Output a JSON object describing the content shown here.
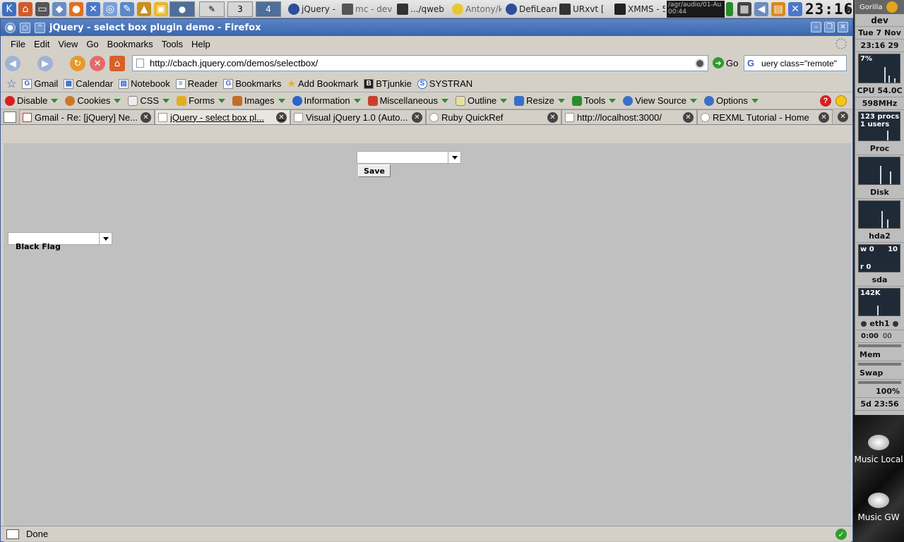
{
  "taskbar": {
    "desktop_number": "3",
    "active_desktop": "4",
    "tasks": [
      {
        "label": "jQuery -",
        "color": "#2b4f9b"
      },
      {
        "label": "mc - dev",
        "color": "#555555"
      },
      {
        "label": ".../qweb",
        "color": "#333333"
      },
      {
        "label": "Antony/k",
        "color": "#e8c830"
      },
      {
        "label": "DefiLearn",
        "color": "#2b4f9b"
      },
      {
        "label": "URxvt [",
        "color": "#333333"
      },
      {
        "label": "XMMS - 5",
        "color": "#222222"
      }
    ],
    "xmms_line1": "/agr/audio/01-Au",
    "xmms_line2": "00:44",
    "clock": "23:16"
  },
  "window": {
    "title": "jQuery - select box plugin demo - Firefox"
  },
  "menu": [
    "File",
    "Edit",
    "View",
    "Go",
    "Bookmarks",
    "Tools",
    "Help"
  ],
  "nav": {
    "url": "http://cbach.jquery.com/demos/selectbox/",
    "go_label": "Go",
    "search_value": "uery class=\"remote\""
  },
  "bookmarks": [
    {
      "label": "Gmail",
      "icon": "G"
    },
    {
      "label": "Calendar",
      "icon": "C"
    },
    {
      "label": "Notebook",
      "icon": "N"
    },
    {
      "label": "Reader",
      "icon": "R"
    },
    {
      "label": "Bookmarks",
      "icon": "G"
    },
    {
      "label": "Add Bookmark",
      "icon": "★"
    },
    {
      "label": "BTjunkie",
      "icon": "B"
    },
    {
      "label": "SYSTRAN",
      "icon": "S"
    }
  ],
  "devtools": [
    {
      "label": "Disable",
      "color": "#d62020"
    },
    {
      "label": "Cookies",
      "color": "#c8782a"
    },
    {
      "label": "CSS",
      "color": "#eeeeee"
    },
    {
      "label": "Forms",
      "color": "#e0b020"
    },
    {
      "label": "Images",
      "color": "#c46b2a"
    },
    {
      "label": "Information",
      "color": "#2a64c8"
    },
    {
      "label": "Miscellaneous",
      "color": "#c8402a"
    },
    {
      "label": "Outline",
      "color": "#e8e0a0"
    },
    {
      "label": "Resize",
      "color": "#3a6fc8"
    },
    {
      "label": "Tools",
      "color": "#2a8c2a"
    },
    {
      "label": "View Source",
      "color": "#3a6fc8"
    },
    {
      "label": "Options",
      "color": "#3a6fc8"
    }
  ],
  "tabs": [
    {
      "label": "Gmail - Re: [jQuery] Ne...",
      "active": false
    },
    {
      "label": "jQuery - select box pl...",
      "active": true
    },
    {
      "label": "Visual jQuery 1.0 (Auto...",
      "active": false
    },
    {
      "label": "Ruby QuickRef",
      "active": false
    },
    {
      "label": "http://localhost:3000/",
      "active": false
    },
    {
      "label": "REXML Tutorial - Home",
      "active": false
    }
  ],
  "page": {
    "save_label": "Save",
    "selected_option": "Black Flag"
  },
  "status": {
    "text": "Done"
  },
  "gkrellm": {
    "theme": "Gorilla",
    "host": "dev",
    "date": "Tue  7 Nov",
    "time": "23:16 29",
    "cpu_pct": "7%",
    "cpu_temp": "CPU 54.0C",
    "cpu_freq": "598MHz",
    "procs": "123 procs",
    "users": "1 users",
    "proc_label": "Proc",
    "disk_label": "Disk",
    "hda2_label": "hda2",
    "hda2_w": "w  0",
    "hda2_w_val": "10",
    "hda2_r": "r   0",
    "sda_label": "sda",
    "sda_val": "142K",
    "eth_label": "eth1",
    "eth_time": "0:00",
    "eth_secs": "00",
    "mem_label": "Mem",
    "swap_label": "Swap",
    "battery": "100%",
    "uptime": "5d 23:56"
  },
  "desktop_icons": [
    "Music Local",
    "Music GW"
  ]
}
